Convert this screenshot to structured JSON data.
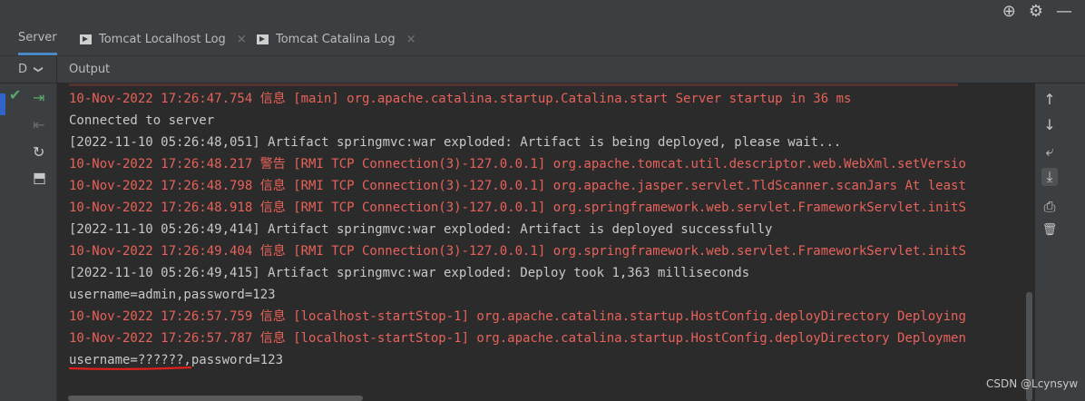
{
  "tabs": [
    {
      "label": "Server",
      "active": true,
      "icon": "none"
    },
    {
      "label": "Tomcat Localhost Log",
      "active": false,
      "icon": "run-config-icon",
      "close": "×"
    },
    {
      "label": "Tomcat Catalina Log",
      "active": false,
      "icon": "run-config-icon",
      "close": "×"
    }
  ],
  "subbar": {
    "dropdown_label": "D",
    "dropdown_chevron": "❯",
    "output_label": "Output"
  },
  "top_icons": [
    {
      "name": "target-icon",
      "glyph": "⊕"
    },
    {
      "name": "gear-icon",
      "glyph": "⚙"
    },
    {
      "name": "minimize-icon",
      "glyph": "—"
    }
  ],
  "gutter_icons": [
    {
      "name": "check-icon",
      "glyph": "✔",
      "color": "#59a869"
    },
    {
      "name": "deploy-icon",
      "glyph": "⇥",
      "color": "#59a869"
    },
    {
      "name": "undeploy-icon",
      "glyph": "⇤",
      "color": "#6b6b6b"
    },
    {
      "name": "refresh-icon",
      "glyph": "↻",
      "color": "#c8c8c8"
    },
    {
      "name": "update-icon",
      "glyph": "⬒",
      "color": "#c8c8c8"
    }
  ],
  "right_icons": [
    {
      "name": "arrow-up-icon",
      "glyph": "↑"
    },
    {
      "name": "arrow-down-icon",
      "glyph": "↓"
    },
    {
      "name": "soft-wrap-icon",
      "glyph": "⤶"
    },
    {
      "name": "scroll-to-end-icon",
      "glyph": "⤓"
    },
    {
      "name": "print-icon",
      "glyph": "⎙"
    },
    {
      "name": "trash-icon",
      "glyph": "🗑"
    }
  ],
  "console_lines": [
    {
      "text": "10-Nov-2022 17:26:47.754 信息 [main] org.apache.catalina.startup.Catalina.start Server startup in 36 ms",
      "color": "red"
    },
    {
      "text": "Connected to server",
      "color": "white"
    },
    {
      "text": "[2022-11-10 05:26:48,051] Artifact springmvc:war exploded: Artifact is being deployed, please wait...",
      "color": "white"
    },
    {
      "text": "10-Nov-2022 17:26:48.217 警告 [RMI TCP Connection(3)-127.0.0.1] org.apache.tomcat.util.descriptor.web.WebXml.setVersio",
      "color": "red"
    },
    {
      "text": "10-Nov-2022 17:26:48.798 信息 [RMI TCP Connection(3)-127.0.0.1] org.apache.jasper.servlet.TldScanner.scanJars At least",
      "color": "red"
    },
    {
      "text": "10-Nov-2022 17:26:48.918 信息 [RMI TCP Connection(3)-127.0.0.1] org.springframework.web.servlet.FrameworkServlet.initS",
      "color": "red"
    },
    {
      "text": "[2022-11-10 05:26:49,414] Artifact springmvc:war exploded: Artifact is deployed successfully",
      "color": "white"
    },
    {
      "text": "10-Nov-2022 17:26:49.404 信息 [RMI TCP Connection(3)-127.0.0.1] org.springframework.web.servlet.FrameworkServlet.initS",
      "color": "red"
    },
    {
      "text": "[2022-11-10 05:26:49,415] Artifact springmvc:war exploded: Deploy took 1,363 milliseconds",
      "color": "white"
    },
    {
      "text": "username=admin,password=123",
      "color": "white"
    },
    {
      "text": "10-Nov-2022 17:26:57.759 信息 [localhost-startStop-1] org.apache.catalina.startup.HostConfig.deployDirectory Deploying",
      "color": "red"
    },
    {
      "text": "10-Nov-2022 17:26:57.787 信息 [localhost-startStop-1] org.apache.catalina.startup.HostConfig.deployDirectory Deploymen",
      "color": "red"
    },
    {
      "text": "username=??????,password=123",
      "color": "white"
    }
  ],
  "colors": {
    "red": "#e8625a",
    "white": "#c8c8c8",
    "underline": "#e0211b",
    "accent": "#4a88c7"
  },
  "watermark": "CSDN @Lcynsyw"
}
